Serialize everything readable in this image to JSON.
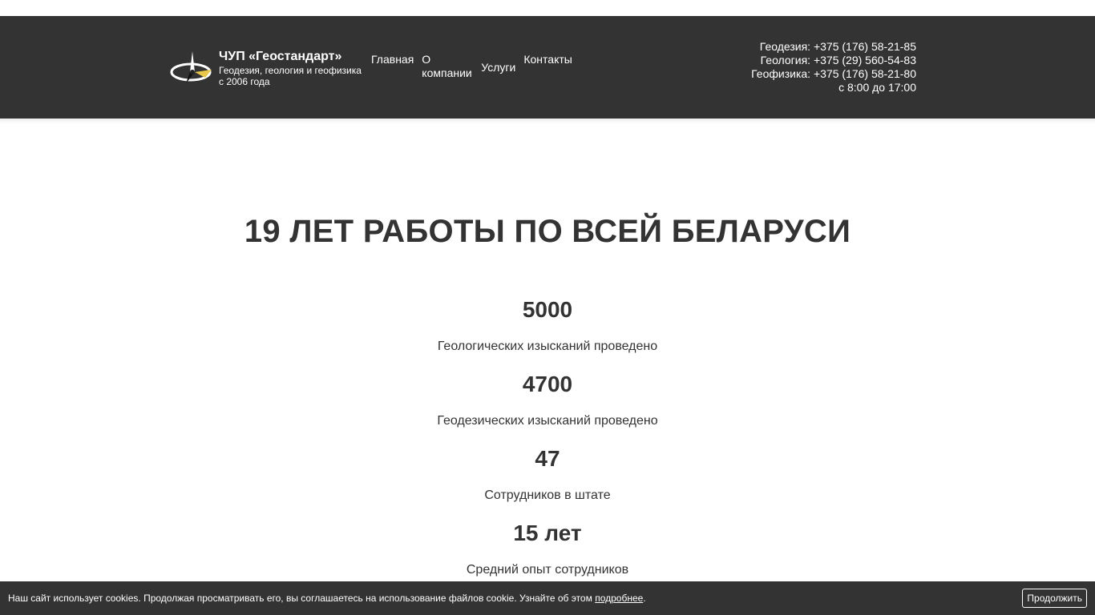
{
  "header": {
    "brand_name": "ЧУП «Геостандарт»",
    "tagline_line1": "Геодезия, геология и геофизика",
    "tagline_line2": "с 2006 года",
    "nav": {
      "home": "Главная",
      "about_line1": "О",
      "about_line2": "компании",
      "services": "Услуги",
      "contacts": "Контакты"
    },
    "contacts": {
      "geodesy": "Геодезия: +375 (176) 58-21-85",
      "geology": "Геология: +375 (29) 560-54-83",
      "geophysics": "Геофизика: +375 (176) 58-21-80",
      "hours": "с 8:00 до 17:00"
    },
    "logo_icon": "compass-needle-logo",
    "colors": {
      "background": "#333333",
      "logo_accent": "#e8c84a"
    }
  },
  "hero": {
    "title": "19 ЛЕТ РАБОТЫ ПО ВСЕЙ БЕЛАРУСИ"
  },
  "stats": [
    {
      "value": "5000",
      "label": "Геологических изысканий проведено"
    },
    {
      "value": "4700",
      "label": "Геодезических изысканий проведено"
    },
    {
      "value": "47",
      "label": "Сотрудников в штате"
    },
    {
      "value": "15 лет",
      "label": "Средний опыт сотрудников"
    }
  ],
  "cookie": {
    "text": "Наш сайт использует cookies. Продолжая просматривать его, вы соглашаетесь на использование файлов cookie. Узнайте об этом ",
    "link": "подробнее",
    "tail": ".",
    "button": "Продолжить"
  }
}
